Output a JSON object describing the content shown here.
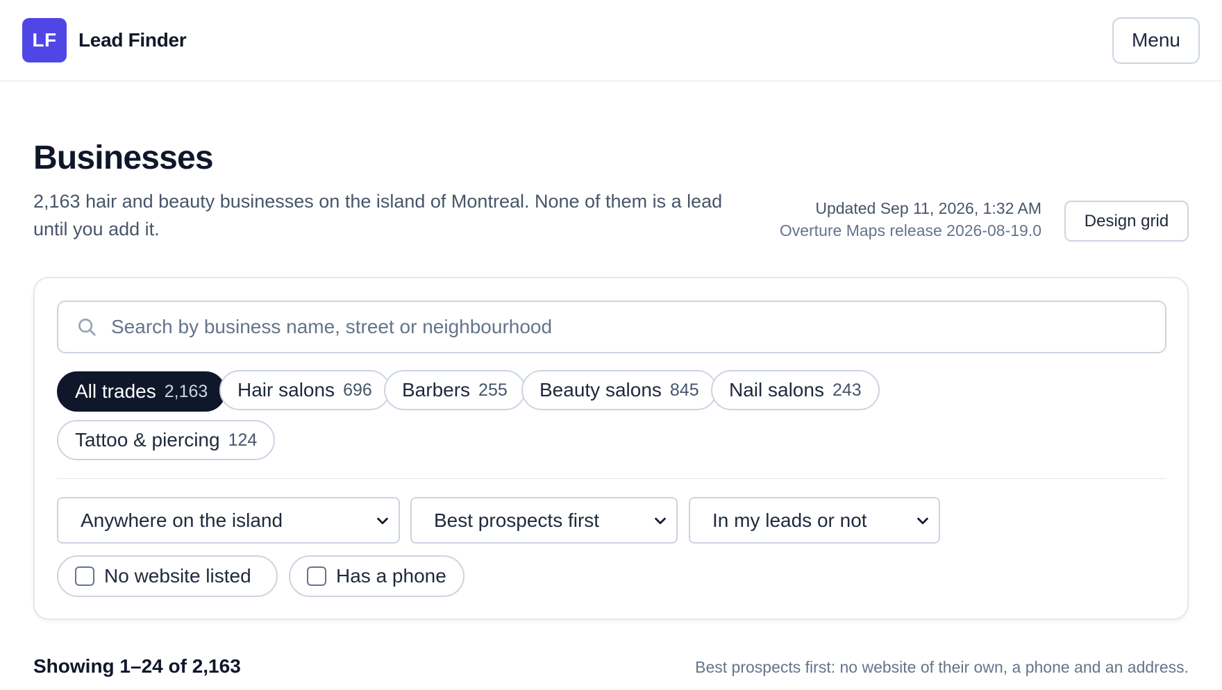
{
  "header": {
    "logo_text": "LF",
    "brand_name": "Lead Finder",
    "menu_label": "Menu"
  },
  "page": {
    "title": "Businesses",
    "intro": "2,163 hair and beauty businesses on the island of Montreal. None of them is a lead until you add it.",
    "updated": "Updated Sep 11, 2026, 1:32 AM",
    "source": "Overture Maps release 2026-08-19.0",
    "design_grid_label": "Design grid"
  },
  "search": {
    "placeholder": "Search by business name, street or neighbourhood",
    "value": ""
  },
  "trades": [
    {
      "label": "All trades",
      "count": "2,163",
      "active": true
    },
    {
      "label": "Hair salons",
      "count": "696",
      "active": false
    },
    {
      "label": "Barbers",
      "count": "255",
      "active": false
    },
    {
      "label": "Beauty salons",
      "count": "845",
      "active": false
    },
    {
      "label": "Nail salons",
      "count": "243",
      "active": false
    },
    {
      "label": "Tattoo & piercing",
      "count": "124",
      "active": false
    }
  ],
  "filters": {
    "area": "Anywhere on the island",
    "sort": "Best prospects first",
    "leads": "In my leads or not",
    "no_website_label": "No website listed",
    "no_website_checked": false,
    "has_phone_label": "Has a phone",
    "has_phone_checked": false
  },
  "results": {
    "showing": "Showing 1–24 of 2,163",
    "sort_note": "Best prospects first: no website of their own, a phone and an address."
  },
  "colors": {
    "brand": "#4f46e5",
    "active_chip": "#0f172a",
    "border": "#cbd5e1"
  }
}
